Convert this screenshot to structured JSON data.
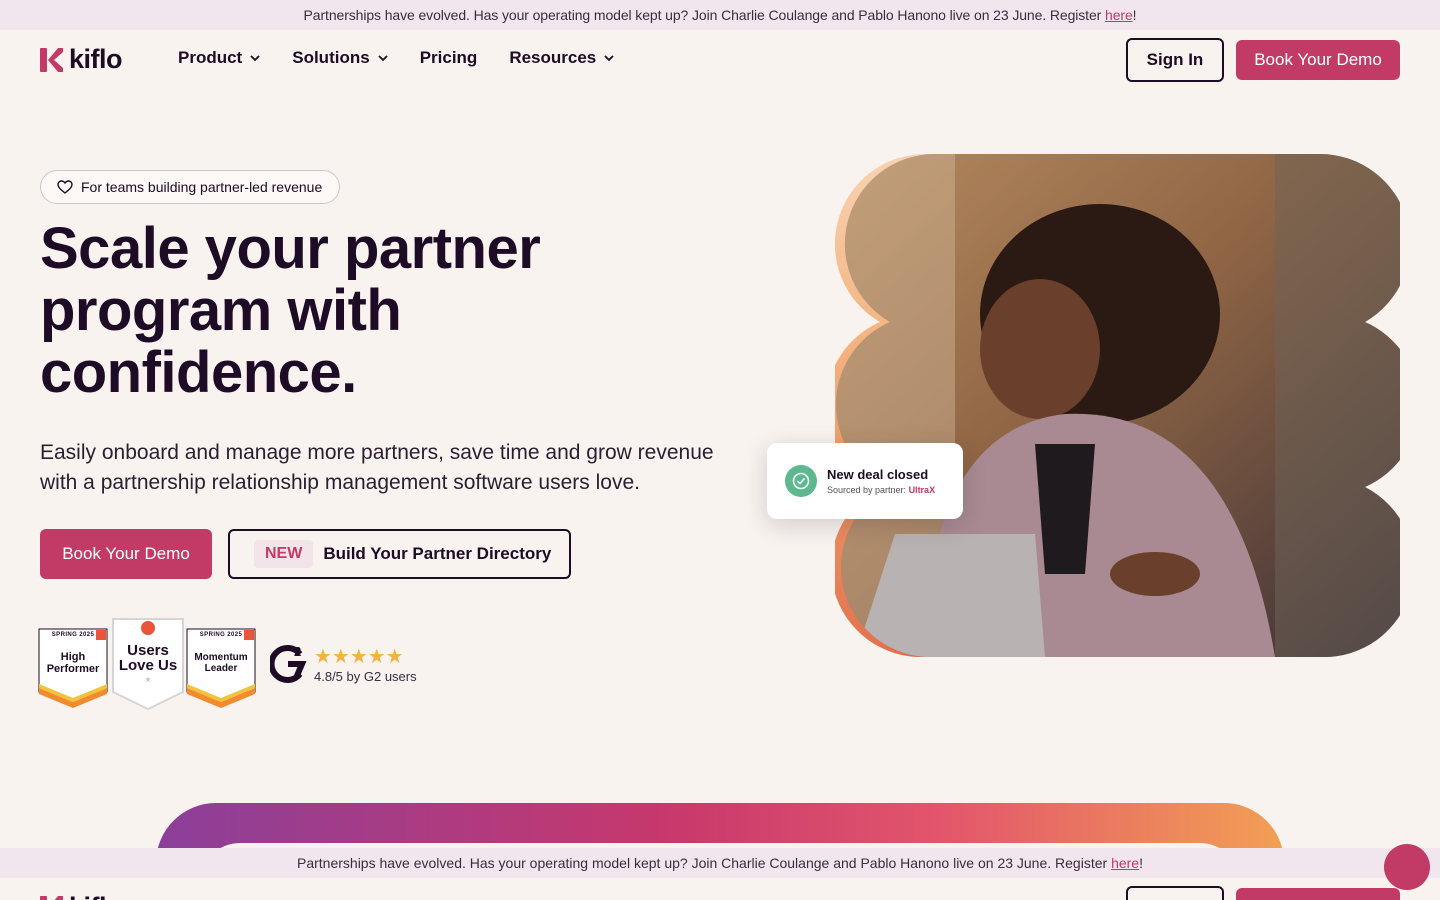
{
  "announcement": {
    "text": "Partnerships have evolved. Has your operating model kept up? Join Charlie Coulange and Pablo Hanono live on 23 June. Register ",
    "link": "here",
    "suffix": "!"
  },
  "brand": {
    "name": "kiflo",
    "color": "#c23a66",
    "dark": "#1e0b26"
  },
  "nav": {
    "items": [
      {
        "label": "Product",
        "dropdown": true
      },
      {
        "label": "Solutions",
        "dropdown": true
      },
      {
        "label": "Pricing",
        "dropdown": false
      },
      {
        "label": "Resources",
        "dropdown": true
      }
    ],
    "signin": "Sign In",
    "demo": "Book Your Demo"
  },
  "hero": {
    "pill": "For teams building partner-led revenue",
    "title": "Scale your partner program with confidence.",
    "subtitle": "Easily onboard and manage more partners, save time and grow revenue with a partnership relationship management software users love.",
    "cta_primary": "Book Your Demo",
    "cta_secondary_tag": "NEW",
    "cta_secondary": "Build Your Partner Directory"
  },
  "badges": [
    {
      "season": "SPRING 2025",
      "label_line1": "High",
      "label_line2": "Performer"
    },
    {
      "season": "",
      "label_line1": "Users",
      "label_line2": "Love Us"
    },
    {
      "season": "SPRING 2025",
      "label_line1": "Momentum",
      "label_line2": "Leader"
    }
  ],
  "g2": {
    "stars": "★★★★★",
    "rating": "4.8/5 by G2 users"
  },
  "toast": {
    "title": "New deal closed",
    "sub_prefix": "Sourced by partner:",
    "partner": "UltraX"
  }
}
